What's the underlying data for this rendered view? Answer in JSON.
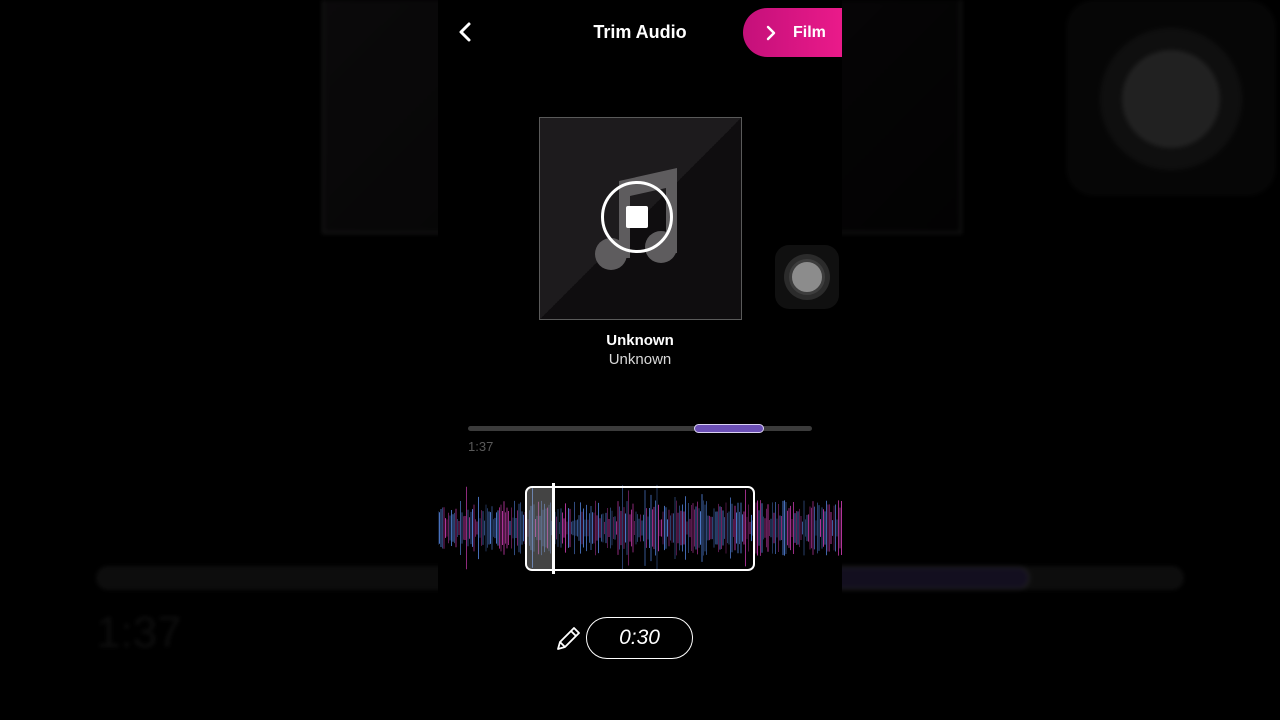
{
  "header": {
    "title": "Trim Audio",
    "back_icon": "chevron-left-icon",
    "next_button_label": "Film",
    "next_button_icon": "chevron-right-icon"
  },
  "track": {
    "title": "Unknown",
    "artist": "Unknown",
    "artwork_icon": "music-note-icon",
    "playback_icon": "stop-icon"
  },
  "scrubber": {
    "position_label": "1:37",
    "window_start_fraction": 0.66,
    "window_end_fraction": 0.86
  },
  "waveform": {
    "playhead_fraction": 0.12
  },
  "duration": {
    "edit_icon": "pencil-icon",
    "value": "0:30"
  },
  "background": {
    "position_label": "1:37"
  },
  "colors": {
    "accent_start": "#c4107a",
    "accent_end": "#ea1a8a",
    "scrub_window": "#6b4fb5",
    "wave_blue": "#5b8ff0",
    "wave_pink": "#d43fb8"
  }
}
